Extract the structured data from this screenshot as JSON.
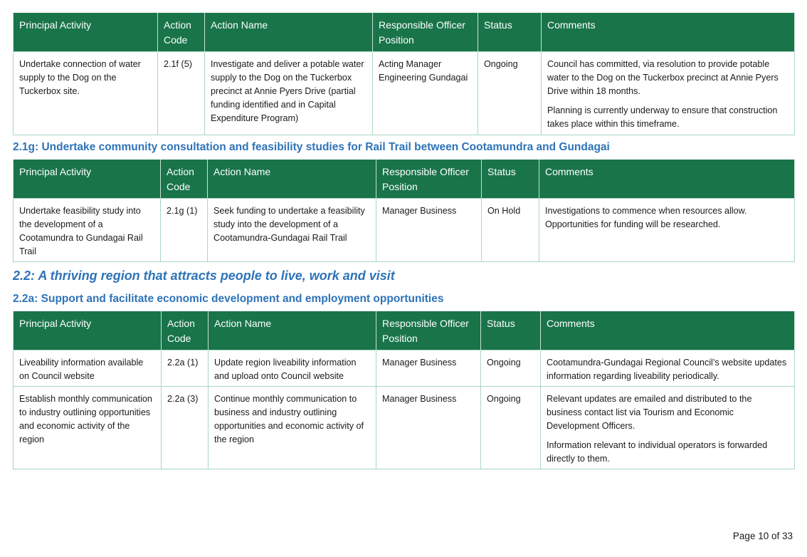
{
  "table_headers": [
    "Principal Activity",
    "Action Code",
    "Action Name",
    "Responsible Officer Position",
    "Status",
    "Comments"
  ],
  "table1": {
    "rows": [
      {
        "principal": "Undertake connection of water supply to the Dog on the Tuckerbox site.",
        "code": "2.1f (5)",
        "action": "Investigate and deliver a potable water supply to the Dog on the Tuckerbox precinct at Annie Pyers Drive (partial funding identified and in Capital Expenditure Program)",
        "officer": "Acting Manager Engineering Gundagai",
        "status": "Ongoing",
        "comments": [
          "Council has committed, via resolution to provide potable water to the Dog on the Tuckerbox precinct at Annie Pyers Drive within 18 months.",
          "Planning is currently underway to ensure that construction takes place within this timeframe."
        ]
      }
    ]
  },
  "heading_21g": "2.1g: Undertake community consultation and feasibility studies for Rail Trail between Cootamundra and Gundagai",
  "table2": {
    "rows": [
      {
        "principal": "Undertake feasibility study into the development of a Cootamundra to Gundagai Rail Trail",
        "code": "2.1g (1)",
        "action": "Seek funding to undertake a feasibility study into the development of a Cootamundra-Gundagai Rail Trail",
        "officer": "Manager Business",
        "status": "On Hold",
        "comments": [
          "Investigations to commence when resources allow. Opportunities for funding will be researched."
        ]
      }
    ]
  },
  "heading_22": "2.2: A thriving region that attracts people to live, work and visit",
  "heading_22a": "2.2a: Support and facilitate economic development and employment opportunities",
  "table3": {
    "rows": [
      {
        "principal": "Liveability information available on Council website",
        "code": "2.2a (1)",
        "action": "Update region liveability information and upload onto Council website",
        "officer": "Manager Business",
        "status": "Ongoing",
        "comments": [
          "Cootamundra-Gundagai Regional Council’s website updates information regarding liveability periodically."
        ]
      },
      {
        "principal": "Establish monthly communication to industry outlining opportunities and economic activity of the region",
        "code": "2.2a (3)",
        "action": "Continue monthly communication to business and industry outlining opportunities and economic activity of the region",
        "officer": "Manager Business",
        "status": "Ongoing",
        "comments": [
          "Relevant updates are emailed and distributed to the business contact list via Tourism and Economic Development Officers.",
          "Information relevant to individual operators is forwarded directly to them."
        ]
      }
    ]
  },
  "footer": {
    "page_label": "Page 10 of 33"
  },
  "colors": {
    "header_green": "#19744a",
    "heading_blue": "#2e73b8",
    "border_teal": "#a9d6c0"
  }
}
